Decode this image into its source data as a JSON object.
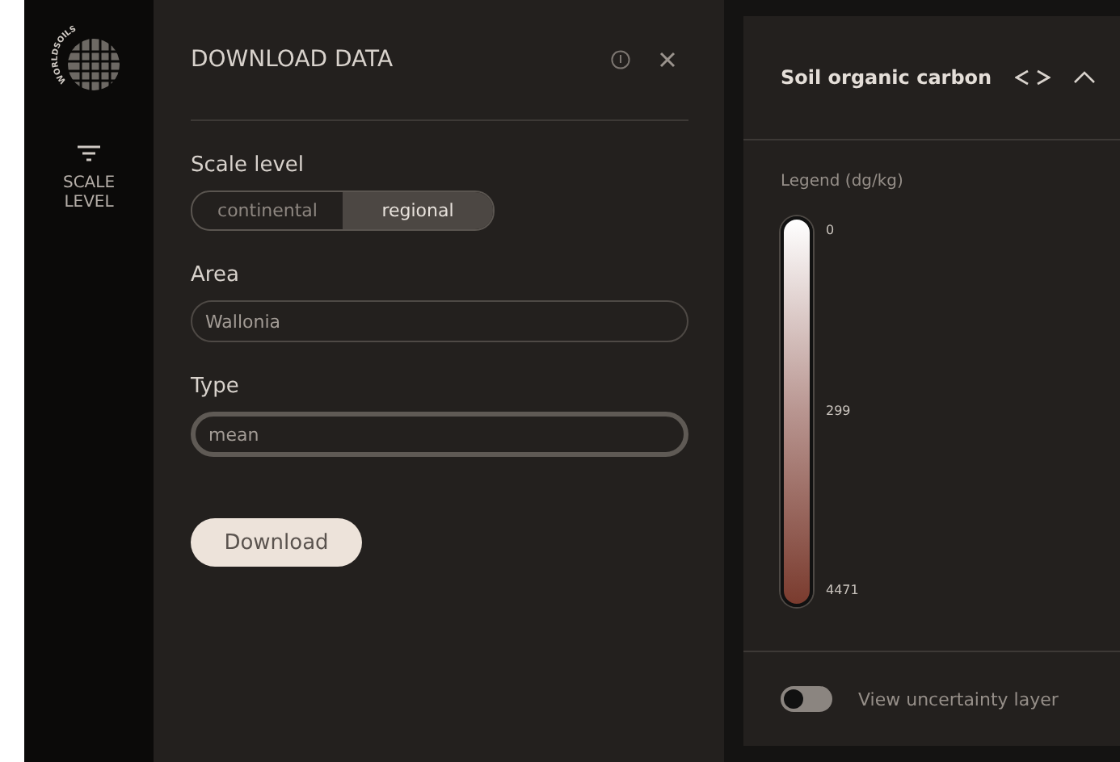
{
  "logo": {
    "text": "WORLDSOILS"
  },
  "sidebar": {
    "items": [
      {
        "label": "SCALE LEVEL"
      }
    ]
  },
  "panel": {
    "title": "DOWNLOAD DATA",
    "scale_level": {
      "label": "Scale level",
      "options": [
        {
          "label": "continental",
          "selected": false
        },
        {
          "label": "regional",
          "selected": true
        }
      ]
    },
    "area": {
      "label": "Area",
      "value": "Wallonia"
    },
    "type": {
      "label": "Type",
      "value": "mean"
    },
    "button": "Download"
  },
  "legend": {
    "title": "Soil organic carbon",
    "subtitle": "Legend (dg/kg)",
    "ticks": [
      "0",
      "299",
      "4471"
    ],
    "uncertainty": {
      "label": "View uncertainty layer",
      "on": false
    }
  }
}
